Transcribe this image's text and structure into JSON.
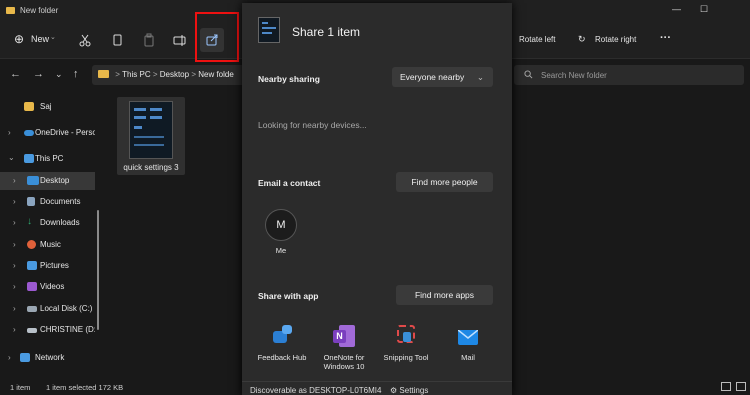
{
  "window": {
    "title": "New folder",
    "minimize": "—",
    "maximize": "☐"
  },
  "toolbar": {
    "new_label": "New",
    "rotate_left": "Rotate left",
    "rotate_right": "Rotate right",
    "more": "···"
  },
  "address": {
    "segments": [
      "This PC",
      "Desktop",
      "New folde"
    ],
    "separator": ">"
  },
  "search": {
    "placeholder": "Search New folder"
  },
  "nav_pane": {
    "items": [
      {
        "label": "Saj",
        "icon": "folder-icon",
        "color": "#e8b84a"
      },
      {
        "label": "OneDrive - Perso",
        "icon": "cloud-icon",
        "color": "#3a8fd8"
      },
      {
        "label": "This PC",
        "icon": "computer-icon",
        "color": "#4a9ae0"
      },
      {
        "label": "Desktop",
        "icon": "desktop-folder-icon",
        "color": "#3a8fd8"
      },
      {
        "label": "Documents",
        "icon": "documents-icon",
        "color": "#8aa4bf"
      },
      {
        "label": "Downloads",
        "icon": "downloads-icon",
        "color": "#2eaa6e"
      },
      {
        "label": "Music",
        "icon": "music-icon",
        "color": "#e0613a"
      },
      {
        "label": "Pictures",
        "icon": "pictures-icon",
        "color": "#4a9ae0"
      },
      {
        "label": "Videos",
        "icon": "videos-icon",
        "color": "#9b59d0"
      },
      {
        "label": "Local Disk (C:)",
        "icon": "drive-icon",
        "color": "#9aa6b2"
      },
      {
        "label": "CHRISTINE (D:)",
        "icon": "usb-drive-icon",
        "color": "#b8c0c8"
      },
      {
        "label": "Network",
        "icon": "network-icon",
        "color": "#4a9ae0"
      }
    ]
  },
  "content": {
    "files": [
      {
        "name": "quick settings 3"
      }
    ]
  },
  "share": {
    "title": "Share 1 item",
    "nearby_heading": "Nearby sharing",
    "nearby_option": "Everyone nearby",
    "looking": "Looking for nearby devices...",
    "email_heading": "Email a contact",
    "find_people": "Find more people",
    "contact": {
      "initial": "M",
      "name": "Me"
    },
    "apps_heading": "Share with app",
    "find_apps": "Find more apps",
    "apps": [
      {
        "name": "Feedback Hub",
        "icon": "feedback-hub-icon",
        "color": "#2b7fd4"
      },
      {
        "name": "OneNote for Windows 10",
        "icon": "onenote-icon",
        "color": "#7b3fbf"
      },
      {
        "name": "Snipping Tool",
        "icon": "snipping-tool-icon",
        "color": "#e04a4a"
      },
      {
        "name": "Mail",
        "icon": "mail-icon",
        "color": "#1e88e5"
      }
    ],
    "discoverable": "Discoverable as DESKTOP-L0T6MI4",
    "settings": "Settings"
  },
  "status": {
    "items": "1 item",
    "selected": "1 item selected  172 KB"
  },
  "colors": {
    "highlight_box": "#e11111",
    "accent": "#4d88c8"
  }
}
